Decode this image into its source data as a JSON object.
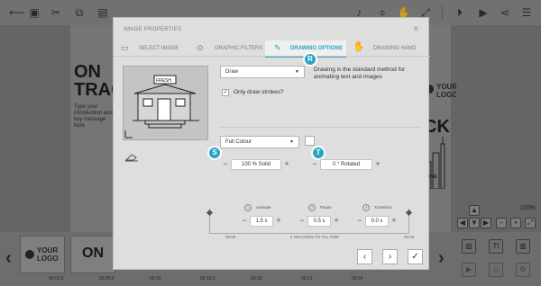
{
  "background": {
    "on_text": "ON",
    "track_text": "TRAC",
    "paragraph": "Type your introduction and key message here",
    "logo_text_line1": "YOUR",
    "logo_text_line2": "LOGO",
    "ck_text": "CK",
    "home_text": "HOME",
    "zoom": "100%"
  },
  "timeline": {
    "thumbs": [
      {
        "label_1": "YOUR",
        "label_2": "LOGO",
        "time": "00:02.5"
      },
      {
        "label_1": "ON",
        "label_2": "",
        "time": "00:05.5"
      },
      {
        "label_1": "",
        "label_2": "",
        "time": "00:10"
      },
      {
        "label_1": "",
        "label_2": "",
        "time": "00:16.5"
      },
      {
        "label_1": "",
        "label_2": "",
        "time": "00:19"
      },
      {
        "label_1": "",
        "label_2": "",
        "time": "00:21"
      },
      {
        "label_1": "",
        "label_2": "",
        "time": "00:24"
      }
    ],
    "tools": [
      "Tt"
    ]
  },
  "dialog": {
    "title": "IMAGE PROPERTIES",
    "tabs": [
      {
        "label": "SELECT IMAGE",
        "icon": "image-icon"
      },
      {
        "label": "GRAPHIC FILTERS",
        "icon": "toggle-icon"
      },
      {
        "label": "DRAWING OPTIONS",
        "icon": "pen-icon"
      },
      {
        "label": "DRAWING HAND",
        "icon": "hand-icon"
      }
    ],
    "badges": {
      "r": "R",
      "s": "S",
      "t": "T"
    },
    "draw_select": "Draw",
    "description": "Drawing is the standard method for animating text and images",
    "only_strokes_label": "Only draw strokes?",
    "colour_select": "Full Colour",
    "opacity_value": "100 % Solid",
    "rotation_value": "0 ° Rotated",
    "timing": {
      "animate_label": "Animate",
      "animate_num": "1",
      "animate_value": "1.5 s",
      "pause_label": "Pause",
      "pause_num": "2",
      "pause_value": "0.5 s",
      "transition_label": "Transition",
      "transition_num": "3",
      "transition_value": "0.0 s",
      "start_time": "00:00",
      "total_text": "2 SECONDS TO TAL TIME",
      "end_time": "00:02"
    },
    "preview_sign": "FRESH"
  },
  "colors": {
    "accent": "#2aa3c6"
  }
}
